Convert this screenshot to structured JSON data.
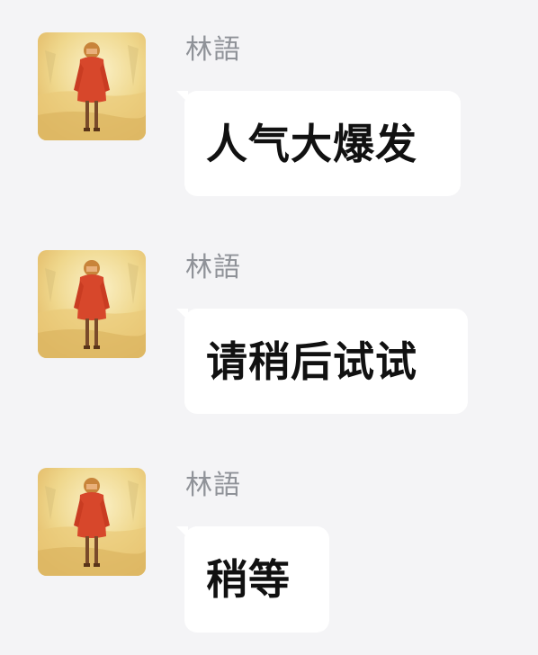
{
  "chat": {
    "messages": [
      {
        "sender": "林語",
        "text": "人气大爆发",
        "avatar_icon": "girl-in-red-coat-illustration"
      },
      {
        "sender": "林語",
        "text": "请稍后试试",
        "avatar_icon": "girl-in-red-coat-illustration"
      },
      {
        "sender": "林語",
        "text": "稍等",
        "avatar_icon": "girl-in-red-coat-illustration"
      }
    ]
  },
  "colors": {
    "background": "#f4f4f6",
    "bubble": "#ffffff",
    "sender_name": "#8f9298",
    "message_text": "#111111",
    "avatar_coat": "#d7472b"
  }
}
